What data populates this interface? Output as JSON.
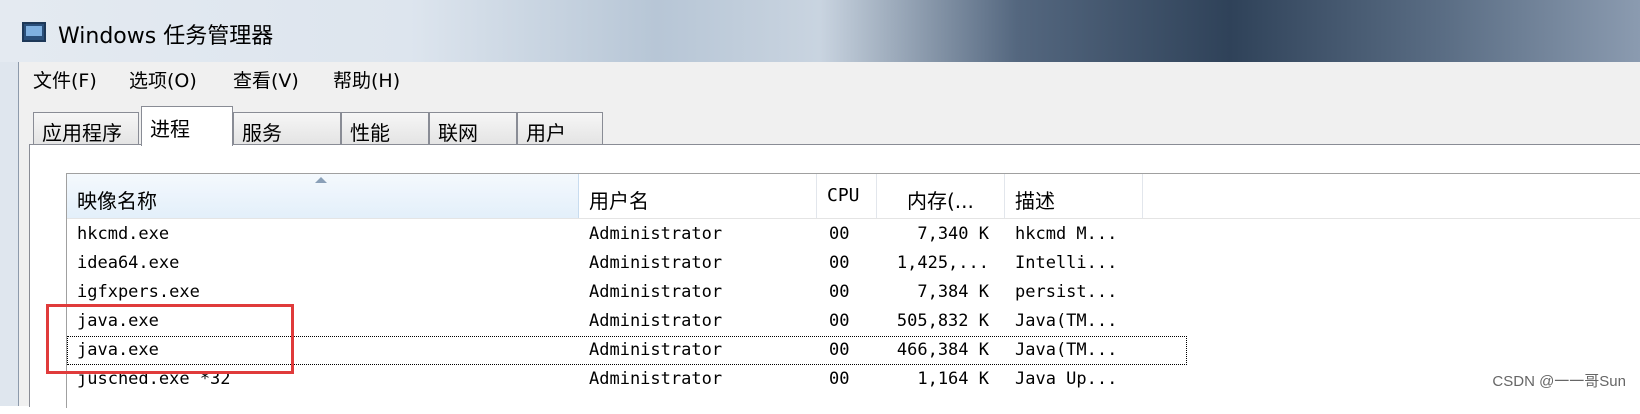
{
  "window": {
    "title": "Windows 任务管理器",
    "icon": "task-manager-icon"
  },
  "menu": [
    "文件(F)",
    "选项(O)",
    "查看(V)",
    "帮助(H)"
  ],
  "tabs": [
    {
      "label": "应用程序",
      "active": false
    },
    {
      "label": "进程",
      "active": true
    },
    {
      "label": "服务",
      "active": false
    },
    {
      "label": "性能",
      "active": false
    },
    {
      "label": "联网",
      "active": false
    },
    {
      "label": "用户",
      "active": false
    }
  ],
  "table": {
    "columns": [
      "映像名称",
      "用户名",
      "CPU",
      "内存(...",
      "描述"
    ],
    "sorted_column": "映像名称",
    "rows": [
      [
        "hkcmd.exe",
        "Administrator",
        "00",
        "7,340 K",
        "hkcmd M..."
      ],
      [
        "idea64.exe",
        "Administrator",
        "00",
        "1,425,...",
        "Intelli..."
      ],
      [
        "igfxpers.exe",
        "Administrator",
        "00",
        "7,384 K",
        "persist..."
      ],
      [
        "java.exe",
        "Administrator",
        "00",
        "505,832 K",
        "Java(TM..."
      ],
      [
        "java.exe",
        "Administrator",
        "00",
        "466,384 K",
        "Java(TM..."
      ],
      [
        "jusched.exe *32",
        "Administrator",
        "00",
        "1,164 K",
        "Java Up..."
      ]
    ],
    "focused_row": 4
  },
  "annotation_color": "#e03b3b",
  "watermark": "CSDN @一一哥Sun"
}
